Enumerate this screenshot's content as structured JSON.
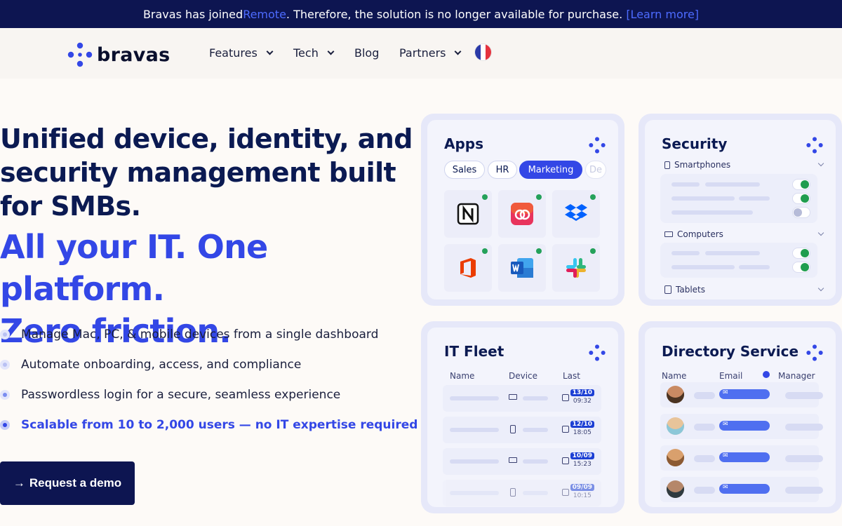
{
  "banner": {
    "prefix": "Bravas has joined ",
    "link": "Remote",
    "suffix": ". Therefore, the solution is no longer available for purchase. ",
    "learn_more": "[Learn more]"
  },
  "nav": {
    "logo_text": "bravas",
    "items": [
      "Features",
      "Tech",
      "Blog",
      "Partners"
    ],
    "language_flag": "fr-flag-icon"
  },
  "hero": {
    "title": "Unified device, identity, and security management built for SMBs.",
    "accent_line1": "All your IT. One platform.",
    "accent_line2": "Zero friction.",
    "bullets": [
      "Manage Mac, PC, & mobile devices from a single dashboard",
      "Automate onboarding, access, and compliance",
      "Passwordless login for a secure, seamless experience",
      "Scalable from 10 to 2,000 users — no IT expertise required"
    ],
    "cta_arrow": "→",
    "cta": "Request a demo"
  },
  "cards": {
    "apps": {
      "title": "Apps",
      "tabs": [
        "Sales",
        "HR",
        "Marketing",
        "De"
      ],
      "active_tab": "Marketing",
      "apps": [
        "notion-icon",
        "creative-cloud-icon",
        "dropbox-icon",
        "office-icon",
        "word-icon",
        "slack-icon"
      ]
    },
    "security": {
      "title": "Security",
      "sections": [
        "Smartphones",
        "Computers",
        "Tablets"
      ]
    },
    "fleet": {
      "title": "IT Fleet",
      "columns": [
        "Name",
        "Device",
        "Last"
      ],
      "rows": [
        {
          "device": "laptop",
          "date": "13/10",
          "time": "09:32"
        },
        {
          "device": "phone",
          "date": "12/10",
          "time": "18:05"
        },
        {
          "device": "laptop",
          "date": "10/09",
          "time": "15:23"
        },
        {
          "device": "phone",
          "date": "09/09",
          "time": "10:15"
        }
      ]
    },
    "directory": {
      "title": "Directory Service",
      "columns": [
        "Name",
        "Email",
        "Manager"
      ]
    }
  },
  "colors": {
    "navy": "#0d1551",
    "accent": "#3347e6",
    "link": "#4d6bff",
    "status_green": "#24a15a"
  }
}
